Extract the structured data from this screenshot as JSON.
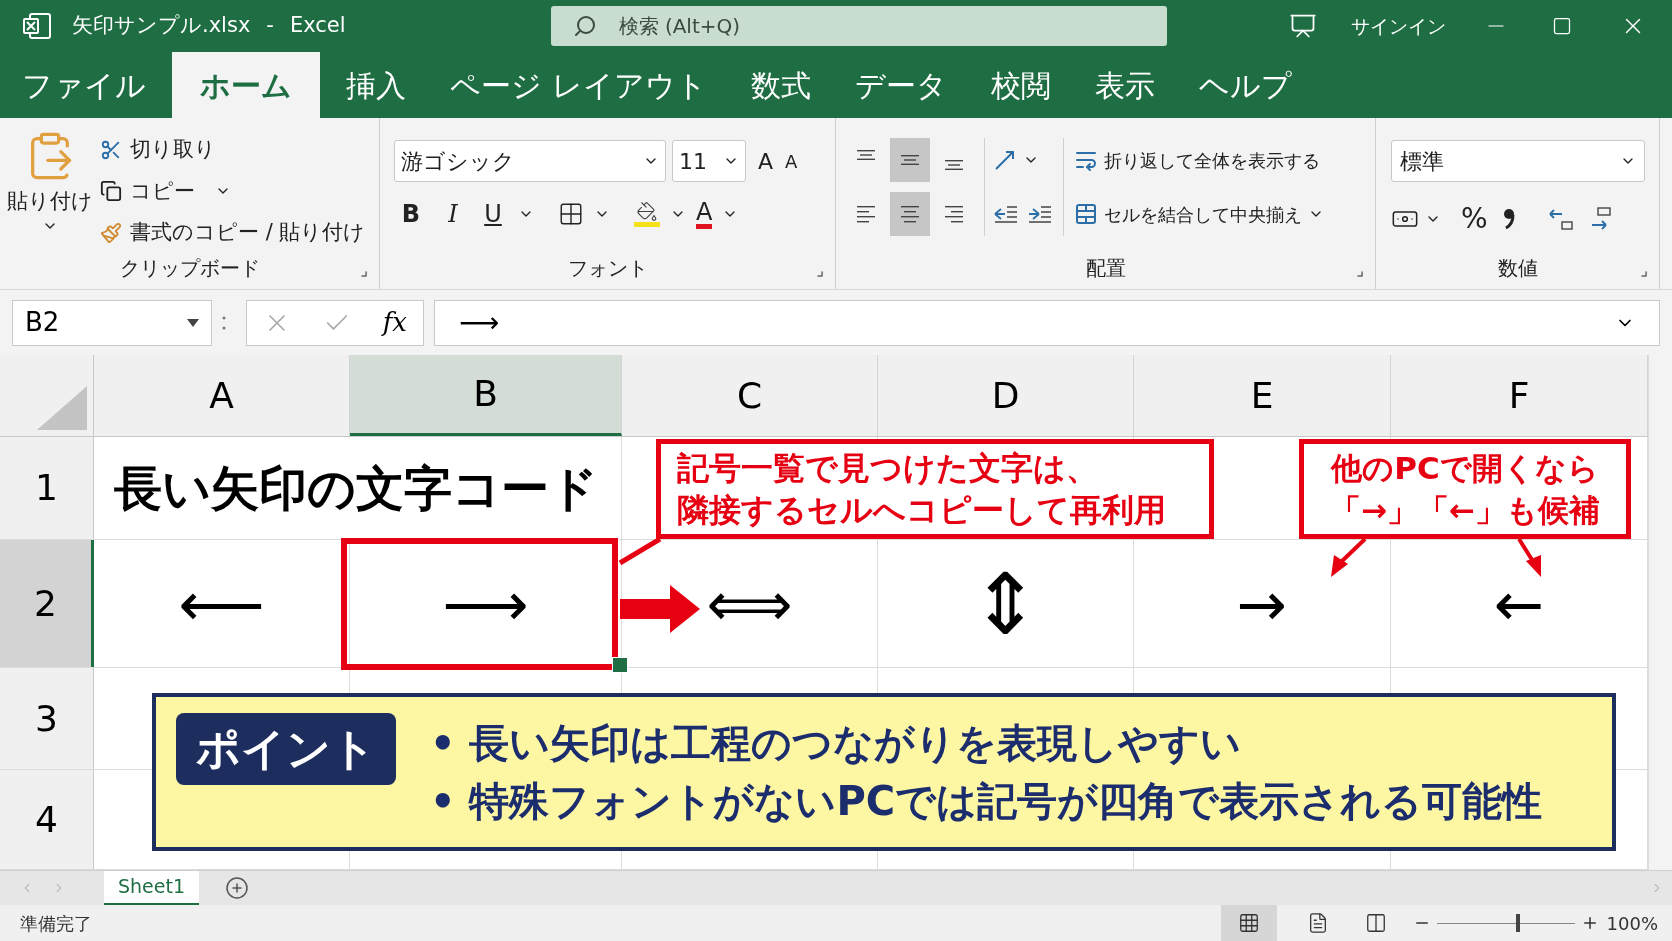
{
  "title_bar": {
    "file_name": "矢印サンプル.xlsx",
    "separator": "-",
    "app_name": "Excel",
    "search_placeholder": "検索 (Alt+Q)",
    "sign_in": "サインイン"
  },
  "menu_tabs": [
    {
      "label": "ファイル",
      "selected": false
    },
    {
      "label": "ホーム",
      "selected": true
    },
    {
      "label": "挿入",
      "selected": false
    },
    {
      "label": "ページ レイアウト",
      "selected": false
    },
    {
      "label": "数式",
      "selected": false
    },
    {
      "label": "データ",
      "selected": false
    },
    {
      "label": "校閲",
      "selected": false
    },
    {
      "label": "表示",
      "selected": false
    },
    {
      "label": "ヘルプ",
      "selected": false
    }
  ],
  "ribbon": {
    "clipboard": {
      "paste": "貼り付け",
      "cut": "切り取り",
      "copy": "コピー",
      "format_painter": "書式のコピー / 貼り付け",
      "label": "クリップボード"
    },
    "font": {
      "font_name": "游ゴシック",
      "font_size": "11",
      "grow": "A",
      "shrink": "A",
      "bold": "B",
      "italic": "I",
      "underline": "U",
      "font_color": "A",
      "label": "フォント"
    },
    "alignment": {
      "vertical": [
        {
          "selected": false
        },
        {
          "selected": true
        },
        {
          "selected": false
        }
      ],
      "horizontal": [
        {
          "selected": false
        },
        {
          "selected": true
        },
        {
          "selected": false
        }
      ],
      "wrap": "折り返して全体を表示する",
      "merge": "セルを結合して中央揃え",
      "label": "配置"
    },
    "number": {
      "format": "標準",
      "percent": "%",
      "label": "数値"
    }
  },
  "formula_bar": {
    "name_box": "B2",
    "function_label": "fx",
    "content": "⟶"
  },
  "columns": [
    {
      "label": "A",
      "selected": false
    },
    {
      "label": "B",
      "selected": true
    },
    {
      "label": "C",
      "selected": false
    },
    {
      "label": "D",
      "selected": false
    },
    {
      "label": "E",
      "selected": false
    },
    {
      "label": "F",
      "selected": false
    }
  ],
  "rows": [
    {
      "label": "1",
      "selected": false,
      "cells": [
        {
          "text": "長い矢印の文字コード",
          "kind": "title"
        },
        {},
        {},
        {},
        {},
        {}
      ]
    },
    {
      "label": "2",
      "selected": true,
      "cells": [
        {
          "text": "⟵",
          "kind": "arrow"
        },
        {
          "text": "⟶",
          "kind": "arrow"
        },
        {
          "text": "⟺",
          "kind": "arrow"
        },
        {
          "text": "⇕",
          "kind": "tall"
        },
        {
          "text": "→",
          "kind": "arrow"
        },
        {
          "text": "←",
          "kind": "arrow"
        }
      ]
    },
    {
      "label": "3",
      "selected": false,
      "cells": [
        {},
        {},
        {},
        {},
        {},
        {}
      ]
    },
    {
      "label": "4",
      "selected": false,
      "cells": [
        {},
        {},
        {},
        {},
        {},
        {}
      ]
    }
  ],
  "callouts": [
    {
      "lines": [
        "記号一覧で見つけた文字は、",
        "隣接するセルへコピーして再利用"
      ]
    },
    {
      "lines": [
        "他のPCで開くなら",
        "「→」「←」も候補"
      ]
    }
  ],
  "point": {
    "badge": "ポイント",
    "bullets": [
      "• 長い矢印は工程のつながりを表現しやすい",
      "• 特殊フォントがないPCでは記号が四角で表示される可能性"
    ]
  },
  "sheet_tabs": [
    {
      "label": "Sheet1",
      "selected": true
    }
  ],
  "status_bar": {
    "status": "準備完了",
    "zoom": "100%",
    "zoom_slider": {
      "level": 0.59
    }
  }
}
